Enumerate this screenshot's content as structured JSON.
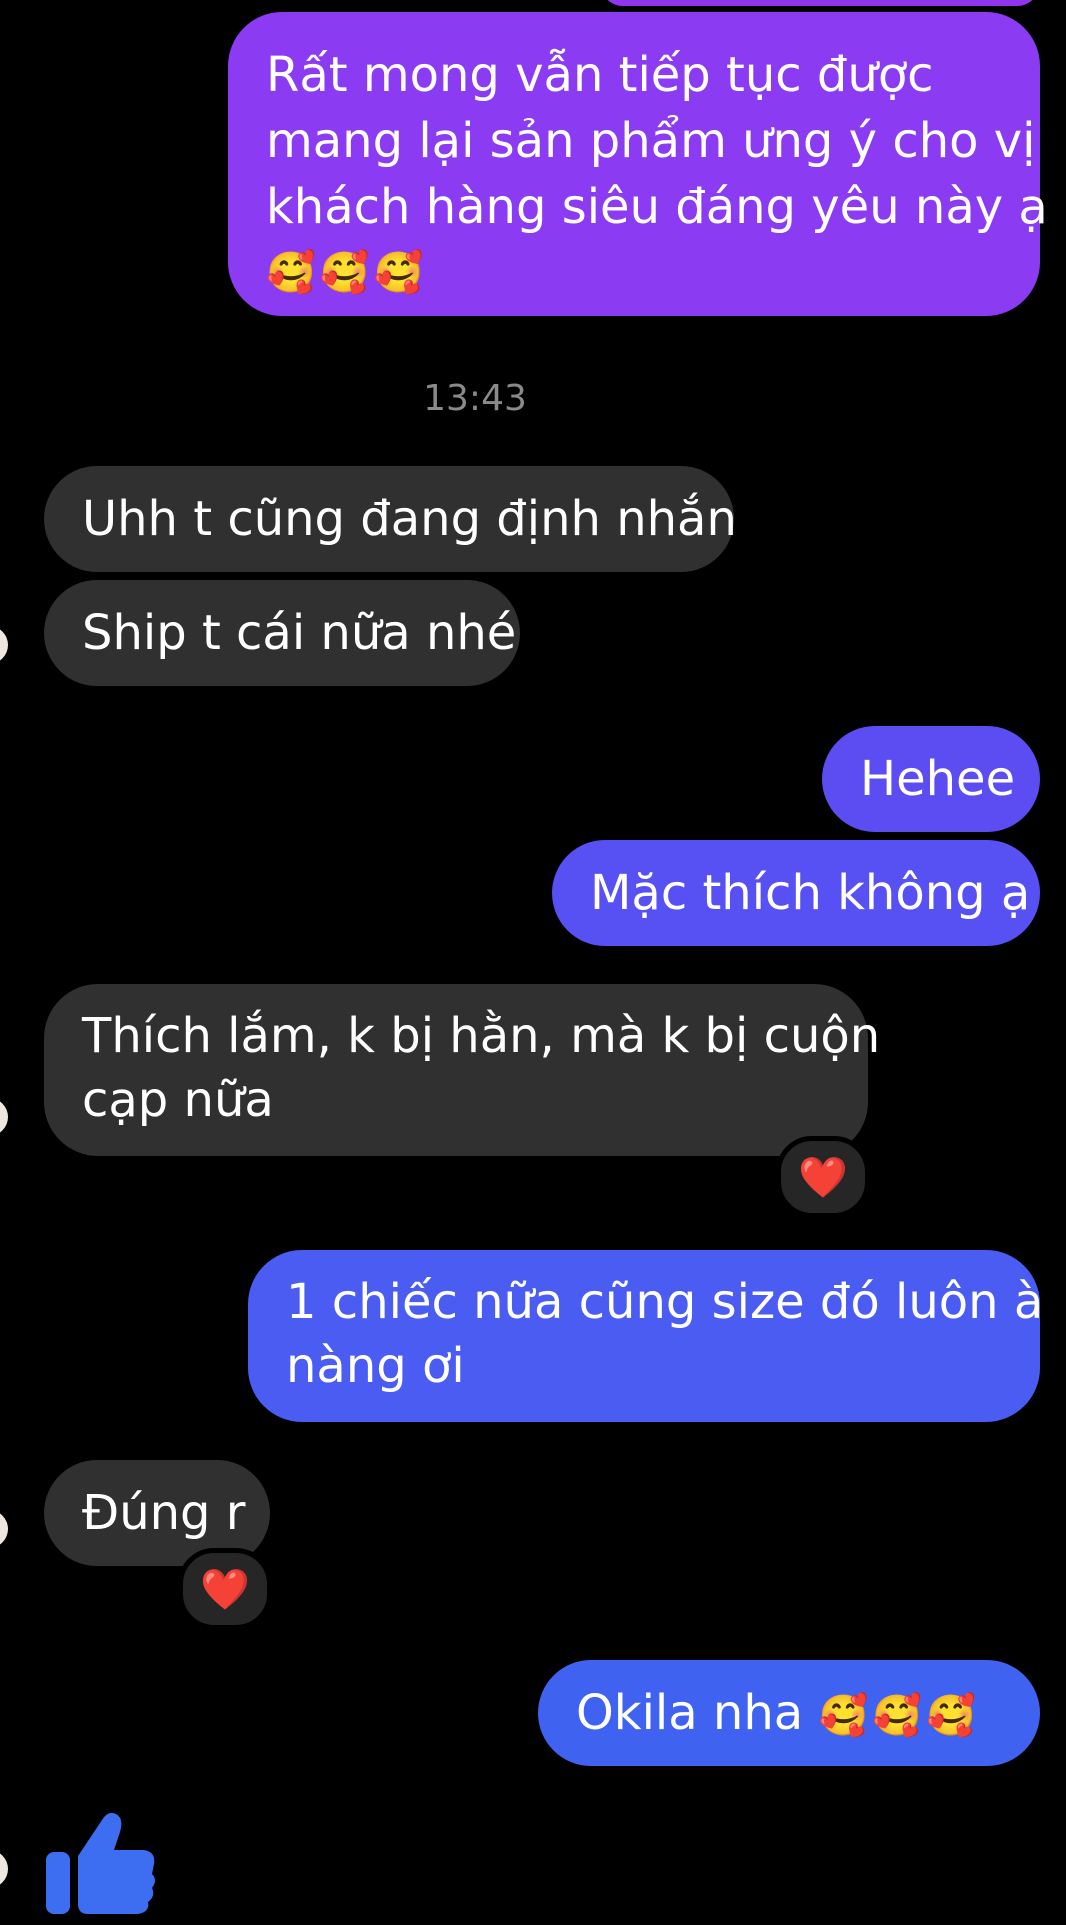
{
  "messages": {
    "m1": {
      "text_lines": [
        "Rất mong vẫn tiếp tục được",
        "mang lại sản phẩm ưng ý cho vị",
        "khách hàng siêu đáng yêu này ạ"
      ],
      "emoji": "🥰🥰🥰"
    },
    "timestamp": "13:43",
    "m2": "Uhh t cũng đang định nhắn",
    "m3": "Ship t cái nữa nhé",
    "m4": "Hehee",
    "m5": "Mặc thích không ạ",
    "m6": {
      "text_lines": [
        "Thích lắm, k bị hằn, mà k bị cuộn",
        "cạp nữa"
      ],
      "reaction": "❤️"
    },
    "m7": {
      "text_lines": [
        "1 chiếc nữa cũng size đó luôn à",
        "nàng ơi"
      ]
    },
    "m8": {
      "text": "Đúng r",
      "reaction": "❤️"
    },
    "m9": {
      "text": "Okila nha",
      "emoji": "🥰🥰🥰"
    }
  },
  "composer": {
    "like_icon": "thumbs-up-icon"
  },
  "colors": {
    "background": "#000000",
    "incoming_bubble": "#303030",
    "outgoing_top": "#8a3ff0",
    "outgoing_bottom": "#3f63f0",
    "like": "#3d6ef2"
  }
}
